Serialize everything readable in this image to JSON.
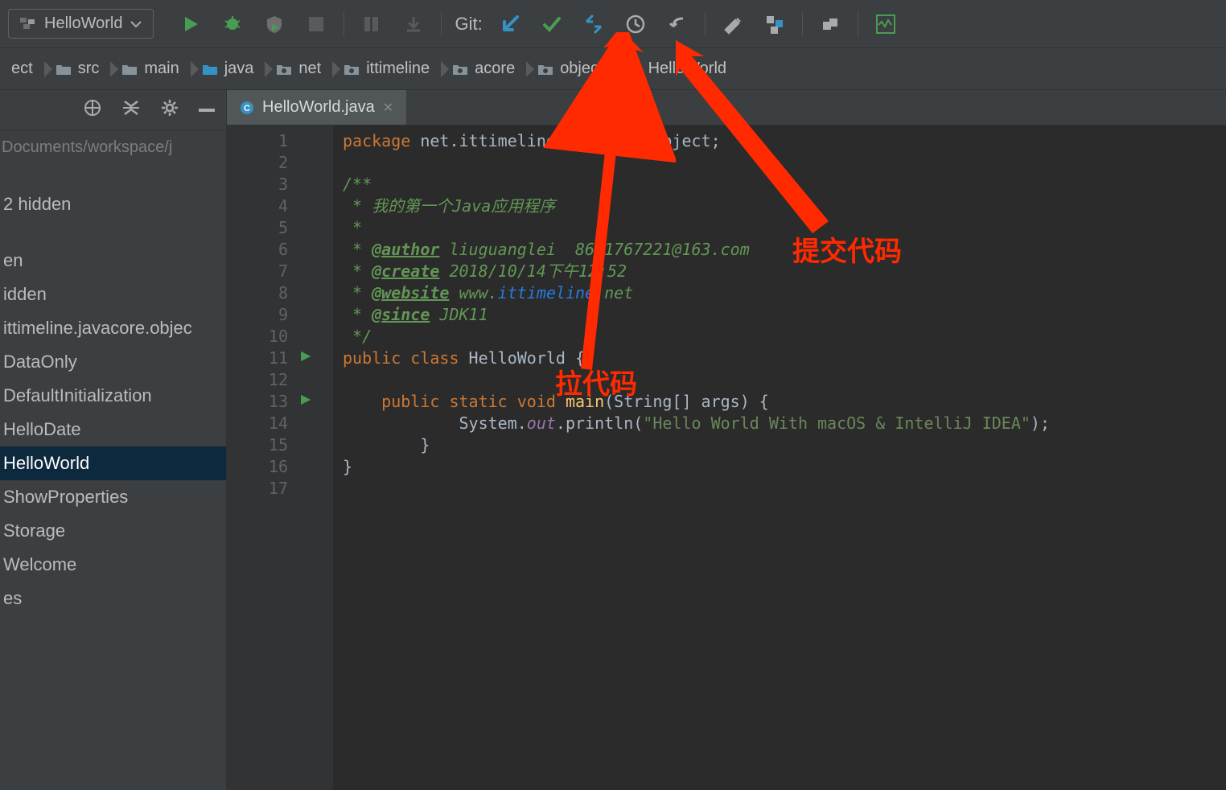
{
  "toolbar": {
    "config_selected": "HelloWorld",
    "git_label": "Git:"
  },
  "breadcrumbs": [
    {
      "label": "ect",
      "icon": "folder"
    },
    {
      "label": "src",
      "icon": "folder"
    },
    {
      "label": "main",
      "icon": "folder"
    },
    {
      "label": "java",
      "icon": "folder-blue"
    },
    {
      "label": "net",
      "icon": "package"
    },
    {
      "label": "ittimeline",
      "icon": "package"
    },
    {
      "label": "acore",
      "icon": "package"
    },
    {
      "label": "object",
      "icon": "package"
    },
    {
      "label": "HelloWorld",
      "icon": "class"
    }
  ],
  "sidebar": {
    "path": "Documents/workspace/j",
    "items": [
      "2 hidden",
      "en",
      "idden",
      "ittimeline.javacore.objec",
      "DataOnly",
      "DefaultInitialization",
      "HelloDate",
      "HelloWorld",
      "ShowProperties",
      "Storage",
      "Welcome",
      "es"
    ],
    "selected_index": 7
  },
  "tab": {
    "label": "HelloWorld.java"
  },
  "code": {
    "line_count": 17,
    "package_kw": "package",
    "package_name": " net.ittimeline.javacore.object;",
    "doc_open": "/**",
    "doc_desc": " * 我的第一个Java应用程序",
    "doc_star": " *",
    "doc_author_tag": "@author",
    "doc_author_val": " liuguanglei  8601767221@163.com",
    "doc_create_tag": "@create",
    "doc_create_val": " 2018/10/14下午12:52",
    "doc_website_tag": "@website",
    "doc_website_pre": " www.",
    "doc_website_link": "ittimeline",
    "doc_website_post": ".net",
    "doc_since_tag": "@since",
    "doc_since_val": " JDK11",
    "doc_close": " */",
    "public_kw": "public",
    "class_kw": " class ",
    "class_name": "HelloWorld ",
    "brace_open": "{",
    "static_kw": " static ",
    "void_kw": "void ",
    "main_fn": "main",
    "main_args": "(String[] args) {",
    "println_pre": "            System.",
    "out_field": "out",
    "println_call": ".println(",
    "hello_str": "\"Hello World With macOS & IntelliJ IDEA\"",
    "println_end": ");",
    "inner_close": "        }",
    "outer_close": "}"
  },
  "annotations": {
    "pull": "拉代码",
    "commit": "提交代码"
  }
}
